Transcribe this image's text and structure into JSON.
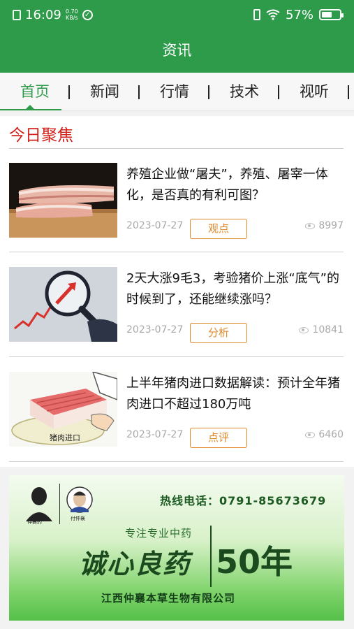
{
  "status_bar": {
    "time": "16:09",
    "net_speed": "0.70\nKB/s",
    "battery": "57%",
    "battery_level": 0.57
  },
  "header": {
    "title": "资讯"
  },
  "tabs": [
    {
      "label": "首页",
      "active": true
    },
    {
      "label": "新闻",
      "active": false
    },
    {
      "label": "行情",
      "active": false
    },
    {
      "label": "技术",
      "active": false
    },
    {
      "label": "视听",
      "active": false
    }
  ],
  "section": {
    "title": "今日聚焦"
  },
  "articles": [
    {
      "headline": "养殖企业做“屠夫”，养殖、屠宰一体化，是否真的有利可图？",
      "date": "2023-07-27",
      "tag": "观点",
      "views": "8997",
      "thumb_icon": "pork-meat-image"
    },
    {
      "headline": "2天大涨9毛3，考验猪价上涨“底气”的时候到了，还能继续涨吗？",
      "date": "2023-07-27",
      "tag": "分析",
      "views": "10841",
      "thumb_icon": "magnifier-rising-chart-image"
    },
    {
      "headline": "上半年猪肉进口数据解读：预计全年猪肉进口不超过180万吨",
      "date": "2023-07-27",
      "tag": "点评",
      "views": "6460",
      "thumb_icon": "imported-pork-box-image"
    }
  ],
  "ad": {
    "hotline": "热线电话：0791-85673679",
    "slogan_small": "专注专业中药",
    "slogan_big": "诚心良药",
    "years": "50年",
    "company": "江西仲襄本草生物有限公司"
  },
  "colors": {
    "brand_green": "#2e9b4a",
    "section_red": "#d0201c",
    "tag_orange": "#e08a2c"
  }
}
